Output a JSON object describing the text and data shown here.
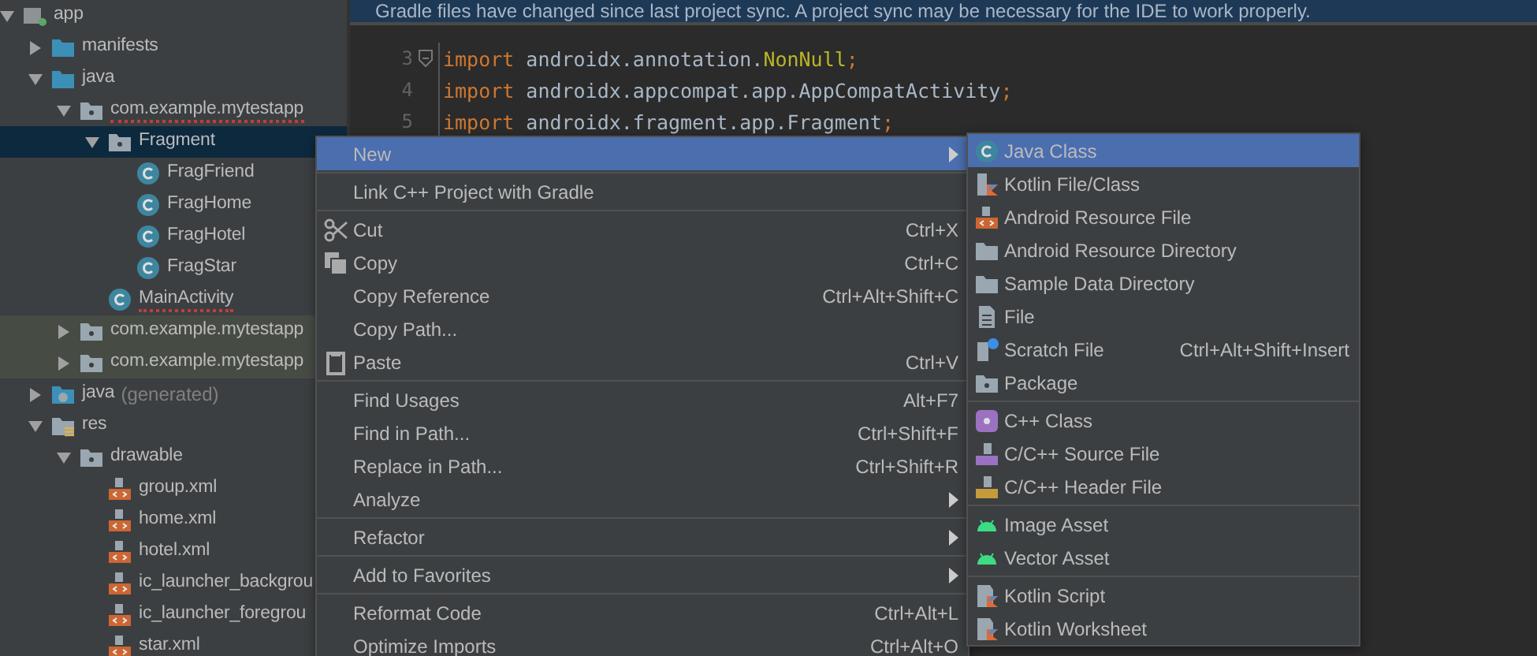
{
  "project_tree": [
    {
      "label": "app",
      "kind": "module",
      "expanded": true,
      "selected": false,
      "highlighted": false,
      "error": false,
      "children": [
        {
          "label": "manifests",
          "kind": "folder",
          "expanded": false,
          "selected": false,
          "highlighted": false,
          "error": false
        },
        {
          "label": "java",
          "kind": "folder",
          "expanded": true,
          "selected": false,
          "highlighted": false,
          "error": false,
          "children": [
            {
              "label": "com.example.mytestapp",
              "kind": "package",
              "expanded": true,
              "selected": false,
              "highlighted": false,
              "error": true,
              "children": [
                {
                  "label": "Fragment",
                  "kind": "package",
                  "expanded": true,
                  "selected": true,
                  "highlighted": false,
                  "error": false,
                  "children": [
                    {
                      "label": "FragFriend",
                      "kind": "class",
                      "selected": false,
                      "highlighted": false,
                      "error": false
                    },
                    {
                      "label": "FragHome",
                      "kind": "class",
                      "selected": false,
                      "highlighted": false,
                      "error": false
                    },
                    {
                      "label": "FragHotel",
                      "kind": "class",
                      "selected": false,
                      "highlighted": false,
                      "error": false
                    },
                    {
                      "label": "FragStar",
                      "kind": "class",
                      "selected": false,
                      "highlighted": false,
                      "error": false
                    }
                  ]
                },
                {
                  "label": "MainActivity",
                  "kind": "class",
                  "selected": false,
                  "highlighted": false,
                  "error": true
                }
              ]
            },
            {
              "label": "com.example.mytestapp",
              "kind": "package",
              "expanded": false,
              "selected": false,
              "highlighted": true,
              "error": false
            },
            {
              "label": "com.example.mytestapp",
              "kind": "package",
              "expanded": false,
              "selected": false,
              "highlighted": true,
              "error": false
            }
          ]
        },
        {
          "label": "java",
          "note": "(generated)",
          "kind": "generated",
          "expanded": false,
          "selected": false,
          "highlighted": false,
          "error": false
        },
        {
          "label": "res",
          "kind": "res",
          "expanded": true,
          "selected": false,
          "highlighted": false,
          "error": false,
          "children": [
            {
              "label": "drawable",
              "kind": "package",
              "expanded": true,
              "selected": false,
              "highlighted": false,
              "error": false,
              "children": [
                {
                  "label": "group.xml",
                  "kind": "xml",
                  "selected": false,
                  "highlighted": false,
                  "error": false
                },
                {
                  "label": "home.xml",
                  "kind": "xml",
                  "selected": false,
                  "highlighted": false,
                  "error": false
                },
                {
                  "label": "hotel.xml",
                  "kind": "xml",
                  "selected": false,
                  "highlighted": false,
                  "error": false
                },
                {
                  "label": "ic_launcher_backgrou",
                  "kind": "xml",
                  "selected": false,
                  "highlighted": false,
                  "error": false
                },
                {
                  "label": "ic_launcher_foregrou",
                  "kind": "xml",
                  "selected": false,
                  "highlighted": false,
                  "error": false
                },
                {
                  "label": "star.xml",
                  "kind": "xml",
                  "selected": false,
                  "highlighted": false,
                  "error": false
                }
              ]
            }
          ]
        }
      ]
    }
  ],
  "banner": {
    "text": "Gradle files have changed since last project sync. A project sync may be necessary for the IDE to work properly."
  },
  "code_lines": [
    {
      "number": "3",
      "fold": true,
      "tokens": [
        {
          "kind": "keyword",
          "text": "import"
        },
        {
          "kind": "plain",
          "text": " androidx.annotation."
        },
        {
          "kind": "annotation",
          "text": "NonNull"
        },
        {
          "kind": "punct",
          "text": ";"
        }
      ]
    },
    {
      "number": "4",
      "fold": false,
      "tokens": [
        {
          "kind": "keyword",
          "text": "import"
        },
        {
          "kind": "plain",
          "text": " androidx.appcompat.app.AppCompatActivity"
        },
        {
          "kind": "punct",
          "text": ";"
        }
      ]
    },
    {
      "number": "5",
      "fold": false,
      "tokens": [
        {
          "kind": "keyword",
          "text": "import"
        },
        {
          "kind": "plain",
          "text": " androidx.fragment.app.Fragment"
        },
        {
          "kind": "punct",
          "text": ";"
        }
      ]
    }
  ],
  "context_menu": {
    "sections": [
      [
        {
          "label": "New",
          "kind": "plain",
          "submenu": true,
          "selected": true
        }
      ],
      [
        {
          "label": "Link C++ Project with Gradle",
          "kind": "plain",
          "submenu": false,
          "selected": false
        }
      ],
      [
        {
          "label": "Cut",
          "shortcut": "Ctrl+X",
          "kind": "cut",
          "submenu": false,
          "selected": false
        },
        {
          "label": "Copy",
          "shortcut": "Ctrl+C",
          "kind": "copy",
          "submenu": false,
          "selected": false
        },
        {
          "label": "Copy Reference",
          "shortcut": "Ctrl+Alt+Shift+C",
          "kind": "plain",
          "submenu": false,
          "selected": false
        },
        {
          "label": "Copy Path...",
          "kind": "plain",
          "submenu": false,
          "selected": false
        },
        {
          "label": "Paste",
          "shortcut": "Ctrl+V",
          "kind": "paste",
          "submenu": false,
          "selected": false
        }
      ],
      [
        {
          "label": "Find Usages",
          "shortcut": "Alt+F7",
          "kind": "plain",
          "submenu": false,
          "selected": false
        },
        {
          "label": "Find in Path...",
          "shortcut": "Ctrl+Shift+F",
          "kind": "plain",
          "submenu": false,
          "selected": false
        },
        {
          "label": "Replace in Path...",
          "shortcut": "Ctrl+Shift+R",
          "kind": "plain",
          "submenu": false,
          "selected": false
        },
        {
          "label": "Analyze",
          "kind": "plain",
          "submenu": true,
          "selected": false
        }
      ],
      [
        {
          "label": "Refactor",
          "kind": "plain",
          "submenu": true,
          "selected": false
        }
      ],
      [
        {
          "label": "Add to Favorites",
          "kind": "plain",
          "submenu": true,
          "selected": false
        }
      ],
      [
        {
          "label": "Reformat Code",
          "shortcut": "Ctrl+Alt+L",
          "kind": "plain",
          "submenu": false,
          "selected": false
        },
        {
          "label": "Optimize Imports",
          "shortcut": "Ctrl+Alt+O",
          "kind": "plain",
          "submenu": false,
          "selected": false
        }
      ]
    ]
  },
  "submenu": {
    "sections": [
      [
        {
          "label": "Java Class",
          "kind": "class",
          "selected": true
        },
        {
          "label": "Kotlin File/Class",
          "kind": "kotlin",
          "selected": false
        },
        {
          "label": "Android Resource File",
          "kind": "resource",
          "selected": false
        },
        {
          "label": "Android Resource Directory",
          "kind": "directory",
          "selected": false
        },
        {
          "label": "Sample Data Directory",
          "kind": "directory",
          "selected": false
        },
        {
          "label": "File",
          "kind": "file",
          "selected": false
        },
        {
          "label": "Scratch File",
          "shortcut": "Ctrl+Alt+Shift+Insert",
          "kind": "scratch",
          "selected": false
        },
        {
          "label": "Package",
          "kind": "package",
          "selected": false
        }
      ],
      [
        {
          "label": "C++ Class",
          "kind": "cppclass",
          "selected": false
        },
        {
          "label": "C/C++ Source File",
          "kind": "source",
          "selected": false
        },
        {
          "label": "C/C++ Header File",
          "kind": "header",
          "selected": false
        }
      ],
      [
        {
          "label": "Image Asset",
          "kind": "asset",
          "selected": false
        },
        {
          "label": "Vector Asset",
          "kind": "asset",
          "selected": false
        }
      ],
      [
        {
          "label": "Kotlin Script",
          "kind": "script",
          "selected": false
        },
        {
          "label": "Kotlin Worksheet",
          "kind": "script",
          "selected": false
        }
      ]
    ]
  }
}
